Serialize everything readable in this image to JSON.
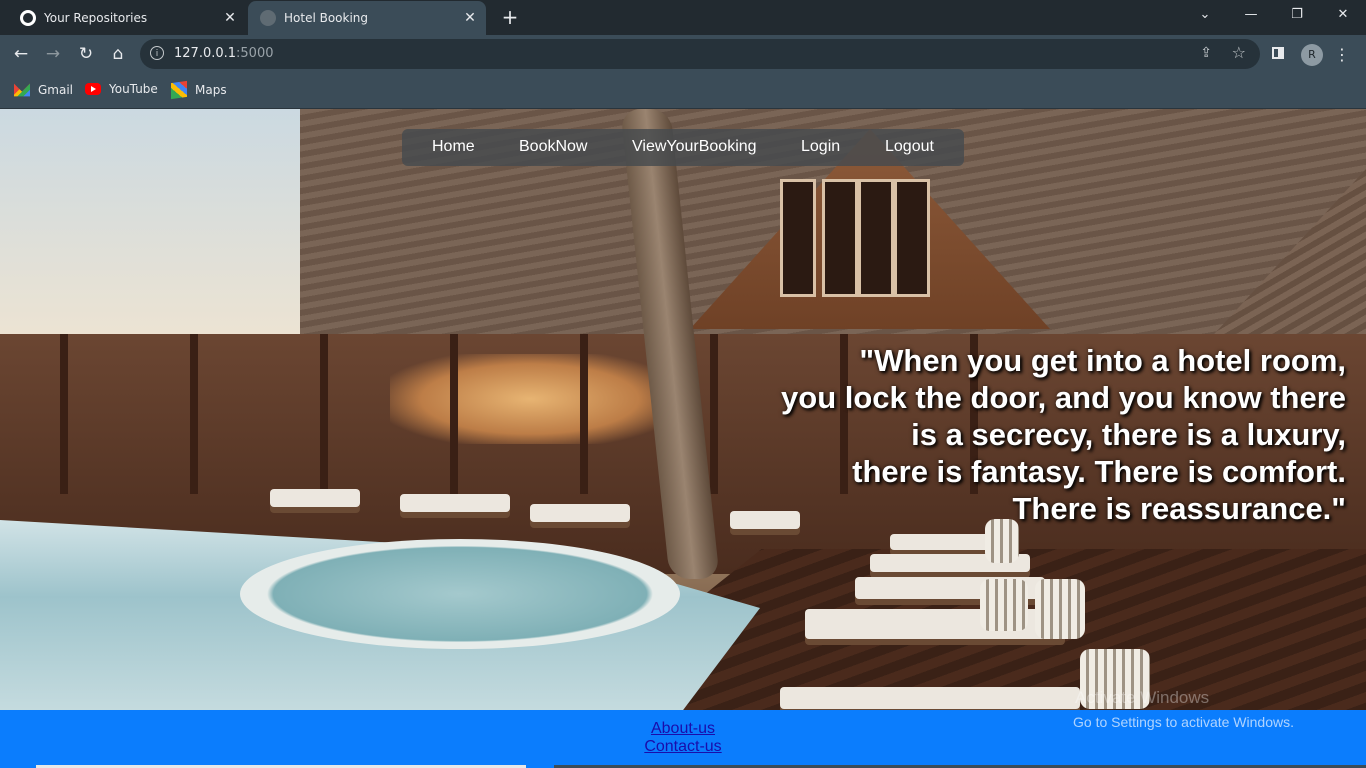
{
  "browser": {
    "tabs": [
      {
        "title": "Your Repositories",
        "active": false
      },
      {
        "title": "Hotel Booking",
        "active": true
      }
    ],
    "new_tab": "+",
    "window_controls": {
      "minimize": "—",
      "restore": "❐",
      "close": "✕",
      "tab_search": "⌄"
    },
    "url": {
      "host": "127.0.0.1",
      "port": ":5000"
    },
    "profile_initial": "R",
    "bookmarks": [
      {
        "label": "Gmail",
        "icon": "gmail-icon"
      },
      {
        "label": "YouTube",
        "icon": "youtube-icon"
      },
      {
        "label": "Maps",
        "icon": "maps-icon"
      }
    ],
    "colors": {
      "tabstrip": "#222a30",
      "toolbar": "#3b4c58"
    }
  },
  "page": {
    "nav": {
      "home": "Home",
      "book_now": "BookNow",
      "view_booking": "ViewYourBooking",
      "login": "Login",
      "logout": "Logout"
    },
    "quote": {
      "line1": "\"When you get into a hotel room,",
      "line2": "you lock the door, and you know there",
      "line3": "is a secrecy, there is a luxury,",
      "line4": "there is fantasy. There is comfort.",
      "line5": "There is reassurance.\""
    },
    "footer": {
      "about": "About-us",
      "contact": "Contact-us",
      "background": "#0b7dfd"
    }
  },
  "os_watermark": {
    "line1": "Activate Windows",
    "line2": "Go to Settings to activate Windows."
  }
}
